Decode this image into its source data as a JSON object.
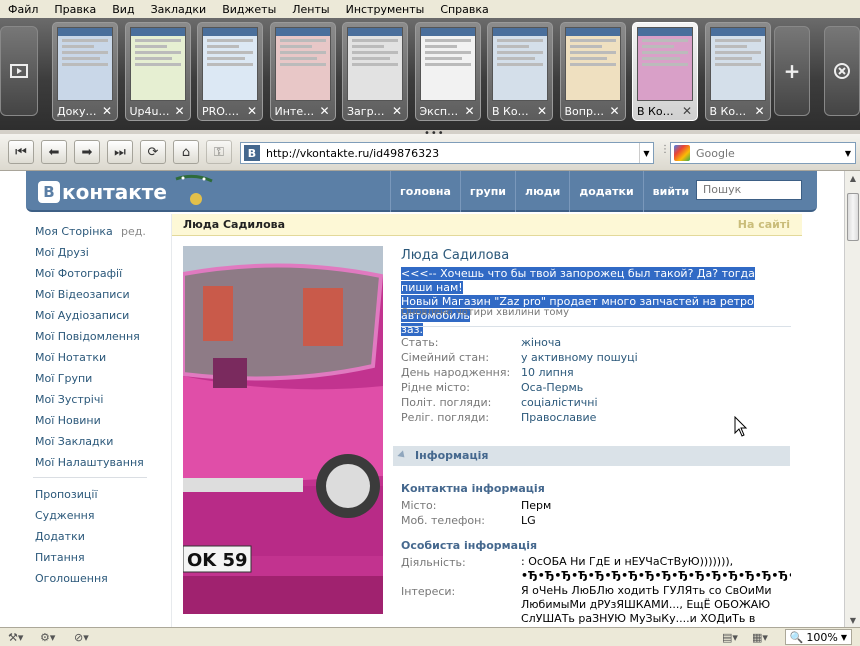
{
  "menu": [
    "Файл",
    "Правка",
    "Вид",
    "Закладки",
    "Виджеты",
    "Ленты",
    "Инструменты",
    "Справка"
  ],
  "tabs": [
    {
      "title": "Доку…",
      "active": false
    },
    {
      "title": "Up4u…",
      "active": false
    },
    {
      "title": "PRO.…",
      "active": false
    },
    {
      "title": "Инте…",
      "active": false
    },
    {
      "title": "Загр…",
      "active": false
    },
    {
      "title": "Эксп…",
      "active": false
    },
    {
      "title": "В Ко…",
      "active": false
    },
    {
      "title": "Вопр…",
      "active": false
    },
    {
      "title": "В Ко…",
      "active": true
    },
    {
      "title": "В Ко…",
      "active": false
    }
  ],
  "address": {
    "url": "http://vkontakte.ru/id49876323",
    "favicon": "B"
  },
  "search": {
    "placeholder": "Google"
  },
  "vk": {
    "logo": "контакте",
    "logo_letter": "B",
    "nav": [
      "головна",
      "групи",
      "люди",
      "додатки",
      "вийти"
    ],
    "search_placeholder": "Пошук"
  },
  "left_menu": {
    "edit": "ред.",
    "main": [
      "Моя Сторінка",
      "Мої Друзі",
      "Мої Фотографії",
      "Мої Відеозаписи",
      "Мої Аудіозаписи",
      "Мої Повідомлення",
      "Мої Нотатки",
      "Мої Групи",
      "Мої Зустрічі",
      "Мої Новини",
      "Мої Закладки",
      "Мої Налаштування"
    ],
    "extra": [
      "Пропозиції",
      "Судження",
      "Додатки",
      "Питання",
      "Оголошення"
    ]
  },
  "profile": {
    "title": "Люда Садилова",
    "online": "На сайті",
    "name": "Люда Садилова",
    "status_lines": [
      "<<<-- Хочешь что бы твой запорожец был такой? Да? тогда пиши нам!",
      "Новый Магазин \"Zaz pro\" продает много запчастей на ретро автомобиль",
      "заз."
    ],
    "updated": "Оновлено чотири хвилини тому",
    "fields": [
      {
        "k": "Стать:",
        "v": "жіноча"
      },
      {
        "k": "Сімейний стан:",
        "v": "у активному пошуці"
      },
      {
        "k": "День народження:",
        "v": "10 липня"
      },
      {
        "k": "Рідне місто:",
        "v": "Оса-Пермь"
      },
      {
        "k": "Політ. погляди:",
        "v": "соціалістичні"
      },
      {
        "k": "Реліг. погляди:",
        "v": "Православие"
      }
    ],
    "info_header": "Інформація",
    "contact_header": "Контактна інформація",
    "contact": [
      {
        "k": "Місто:",
        "v": "Перм"
      },
      {
        "k": "Моб. телефон:",
        "v": "LG"
      }
    ],
    "personal_header": "Особиста інформація",
    "personal": [
      {
        "k": "Діяльність:",
        "v": ": ОсОБА Ни ГдЕ и нЕУЧаСтВуЮ))))))),",
        "v2": "•Ђ•Ђ•Ђ•Ђ•Ђ•Ђ•Ђ•Ђ•Ђ•Ђ•Ђ•Ђ•Ђ•Ђ•Ђ•Ђ•Ђ•"
      },
      {
        "k": "Інтереси:",
        "v": "Я оЧеНь ЛюБЛю ходитЬ ГУЛЯть со СвОиМи",
        "v2": "ЛюбимыМи дРУзЯШКАМИ..., ЕщЁ ОБОЖАЮ",
        "v3": "СлУШАТь раЗНУЮ МуЗыКу....и ХОДиТь в КЛубы"
      }
    ]
  },
  "statusbar": {
    "zoom": "100%"
  }
}
